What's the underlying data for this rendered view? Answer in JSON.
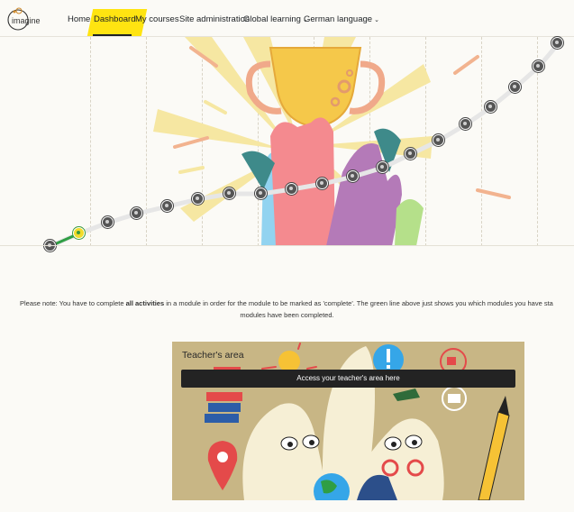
{
  "navbar": {
    "logo_text": "imagine",
    "items": [
      {
        "label": "Home"
      },
      {
        "label": "Dashboard"
      },
      {
        "label": "My courses"
      },
      {
        "label": "Site administration"
      },
      {
        "label": "Global learning"
      },
      {
        "label": "German language"
      }
    ]
  },
  "hero": {
    "completed_modules": 2,
    "total_modules": 21
  },
  "note": {
    "prefix": "Please note: You have to complete ",
    "bold": "all activities",
    "suffix": " in a module in order for the module to be marked as 'complete'. The green line above just shows you which modules you have sta",
    "line2": "modules have been completed."
  },
  "teacher_card": {
    "title": "Teacher's area",
    "action_label": "Access your teacher's area here"
  },
  "colors": {
    "highlight": "#ffe411",
    "progress_green": "#2f9e44",
    "card_bg": "#c8b685",
    "bar_bg": "#232323"
  }
}
